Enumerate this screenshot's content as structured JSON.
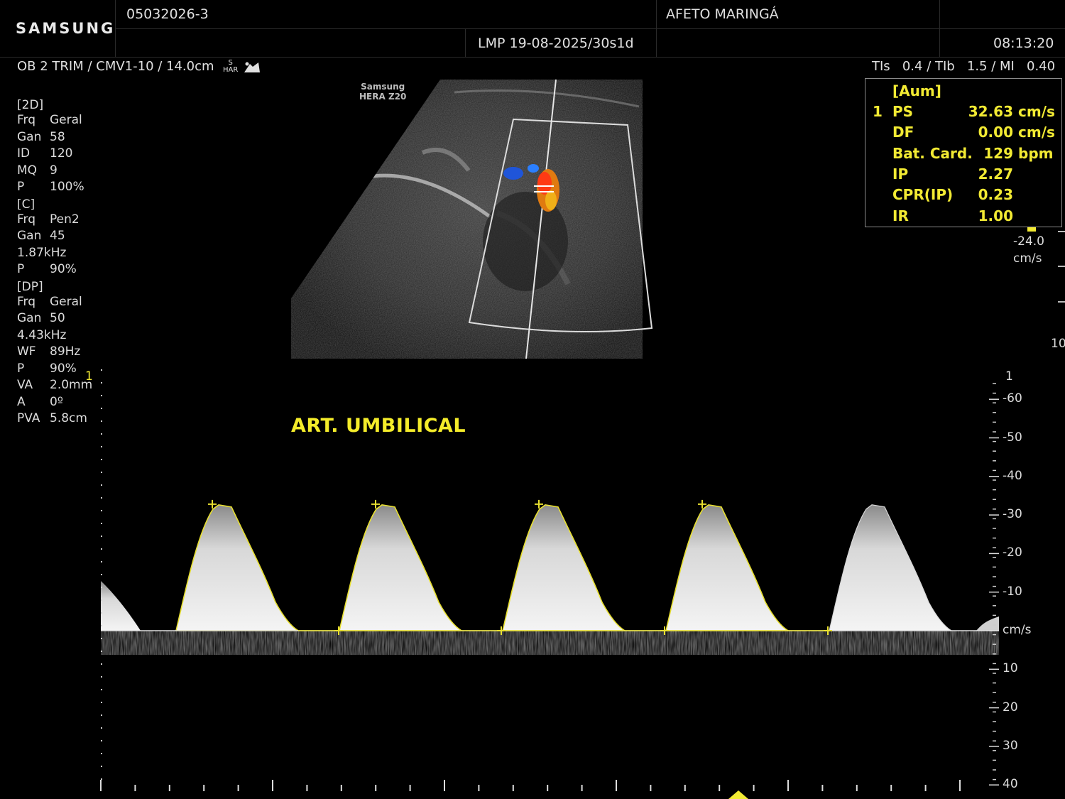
{
  "header": {
    "brand": "SAMSUNG",
    "patient_id": "05032026-3",
    "institution": "AFETO MARINGÁ",
    "lmp": "LMP 19-08-2025/30s1d",
    "time": "08:13:20",
    "preset": "OB 2 TRIM / CMV1-10 / 14.0cm",
    "har_top": "S",
    "har_bottom": "HAR",
    "indices": "TIs   0.4 / TIb   1.5 / MI   0.40"
  },
  "device_label": {
    "line1": "Samsung",
    "line2": "HERA Z20"
  },
  "params": {
    "mode_2d": {
      "title": "[2D]",
      "rows": [
        {
          "k": "Frq",
          "v": "Geral"
        },
        {
          "k": "Gan",
          "v": "58"
        },
        {
          "k": "ID",
          "v": "120"
        },
        {
          "k": "MQ",
          "v": "9"
        },
        {
          "k": "P",
          "v": "100%"
        }
      ]
    },
    "mode_c": {
      "title": "[C]",
      "rows": [
        {
          "k": "Frq",
          "v": "Pen2"
        },
        {
          "k": "Gan",
          "v": "45"
        },
        {
          "k": "",
          "v": "1.87kHz"
        },
        {
          "k": "P",
          "v": "90%"
        }
      ]
    },
    "mode_dp": {
      "title": "[DP]",
      "rows": [
        {
          "k": "Frq",
          "v": "Geral"
        },
        {
          "k": "Gan",
          "v": "50"
        },
        {
          "k": "",
          "v": "4.43kHz"
        },
        {
          "k": "WF",
          "v": "89Hz"
        },
        {
          "k": "P",
          "v": "90%"
        },
        {
          "k": "VA",
          "v": "2.0mm"
        },
        {
          "k": "A",
          "v": "0º"
        },
        {
          "k": "PVA",
          "v": "5.8cm"
        }
      ]
    }
  },
  "measurements": {
    "title": "[Aum]",
    "index": "1",
    "rows": [
      {
        "label": "PS",
        "value": "32.63",
        "unit": "cm/s"
      },
      {
        "label": "DF",
        "value": "0.00",
        "unit": "cm/s"
      },
      {
        "label": "Bat. Card.",
        "value": "129",
        "unit": "bpm"
      },
      {
        "label": "IP",
        "value": "2.27",
        "unit": ""
      },
      {
        "label": "CPR(IP)",
        "value": "0.23",
        "unit": ""
      },
      {
        "label": "IR",
        "value": "1.00",
        "unit": ""
      }
    ]
  },
  "color_scale": {
    "value": "-24.0",
    "unit": "cm/s",
    "right_cut": "10"
  },
  "doppler": {
    "annotation": "ART. UMBILICAL",
    "gate_marker": "1",
    "right_marker": "1",
    "unit": "cm/s",
    "scale_labels": [
      "-60",
      "-50",
      "-40",
      "-30",
      "-20",
      "-10",
      "10",
      "20",
      "30",
      "40"
    ],
    "peak_velocity_cm_s": 32.63,
    "end_diastolic_cm_s": 0.0,
    "colors": {
      "annotation": "#f4ec2a",
      "trace": "#e8e030",
      "measure_box": "#f2ea33"
    }
  }
}
